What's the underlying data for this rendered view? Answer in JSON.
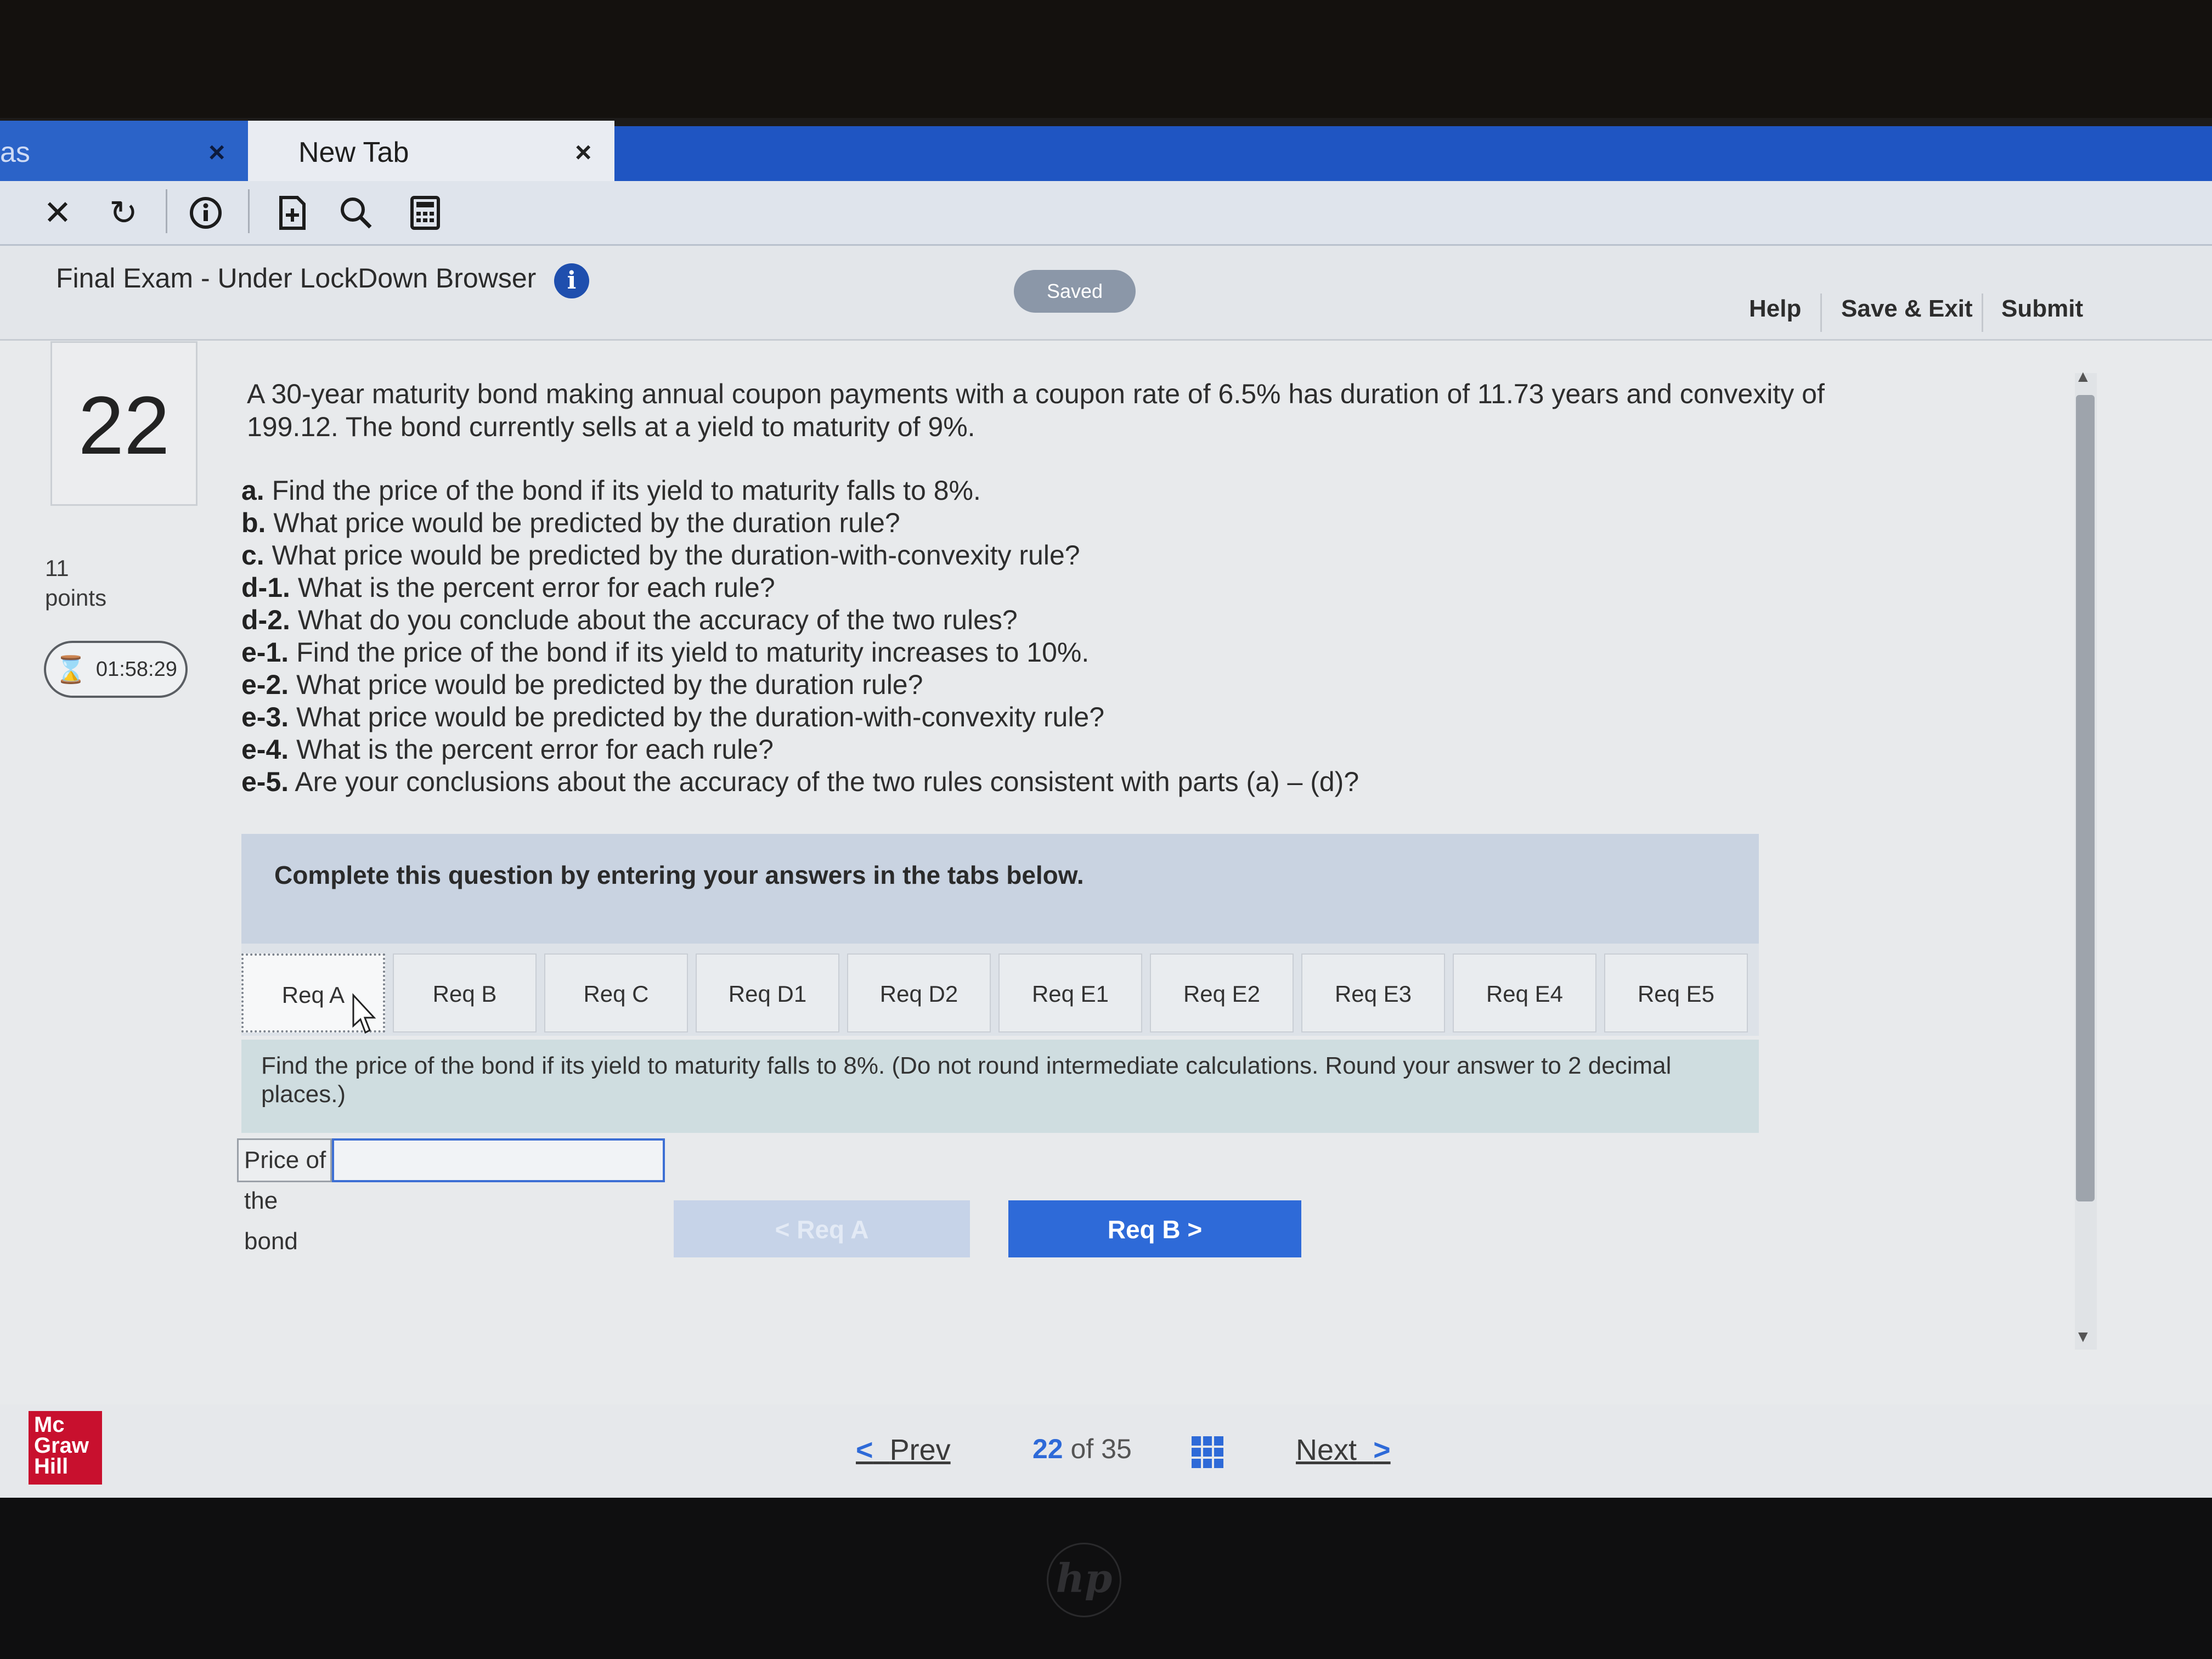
{
  "browser": {
    "tabs": [
      {
        "label": "as",
        "close": "×"
      },
      {
        "label": "New Tab",
        "close": "×"
      }
    ]
  },
  "header": {
    "title": "Final Exam - Under LockDown Browser",
    "info": "i",
    "status": "Saved",
    "links": {
      "help": "Help",
      "save_exit": "Save & Exit",
      "submit": "Submit"
    }
  },
  "question": {
    "number": "22",
    "points_value": "11",
    "points_label": "points",
    "timer": "01:58:29",
    "stem": "A 30-year maturity bond making annual coupon payments with a coupon rate of 6.5% has duration of 11.73 years and convexity of 199.12. The bond currently sells at a yield to maturity of 9%.",
    "parts": [
      {
        "key": "a.",
        "text": "Find the price of the bond if its yield to maturity falls to 8%."
      },
      {
        "key": "b.",
        "text": "What price would be predicted by the duration rule?"
      },
      {
        "key": "c.",
        "text": "What price would be predicted by the duration-with-convexity rule?"
      },
      {
        "key": "d-1.",
        "text": "What is the percent error for each rule?"
      },
      {
        "key": "d-2.",
        "text": "What do you conclude about the accuracy of the two rules?"
      },
      {
        "key": "e-1.",
        "text": "Find the price of the bond if its yield to maturity increases to 10%."
      },
      {
        "key": "e-2.",
        "text": "What price would be predicted by the duration rule?"
      },
      {
        "key": "e-3.",
        "text": "What price would be predicted by the duration-with-convexity rule?"
      },
      {
        "key": "e-4.",
        "text": "What is the percent error for each rule?"
      },
      {
        "key": "e-5.",
        "text": "Are your conclusions about the accuracy of the two rules consistent with parts (a) – (d)?"
      }
    ],
    "instruction": "Complete this question by entering your answers in the tabs below.",
    "req_tabs": [
      "Req A",
      "Req B",
      "Req C",
      "Req D1",
      "Req D2",
      "Req E1",
      "Req E2",
      "Req E3",
      "Req E4",
      "Req E5"
    ],
    "active_tab": "Req A",
    "task": "Find the price of the bond if its yield to maturity falls to 8%. (Do not round intermediate calculations. Round your answer to 2 decimal places.)",
    "field_label": "Price of the bond",
    "field_value": "",
    "prev_req": "< Req A",
    "next_req": "Req B  >"
  },
  "footer": {
    "logo_lines": [
      "Mc",
      "Graw",
      "Hill"
    ],
    "prev": "Prev",
    "current": "22",
    "of": "of",
    "total": "35",
    "next": "Next"
  },
  "device": {
    "brand": "hp"
  },
  "colors": {
    "accent": "#2e6ad8",
    "tab_blue": "#1f55c2",
    "logo_red": "#c8102e",
    "saved_pill": "#8b97a8"
  },
  "icons": [
    "close-icon",
    "reload-icon",
    "info-circle-icon",
    "page-add-icon",
    "search-icon",
    "calculator-icon",
    "hourglass-icon",
    "grid-icon",
    "chevron-left-icon",
    "chevron-right-icon",
    "cursor-icon"
  ]
}
